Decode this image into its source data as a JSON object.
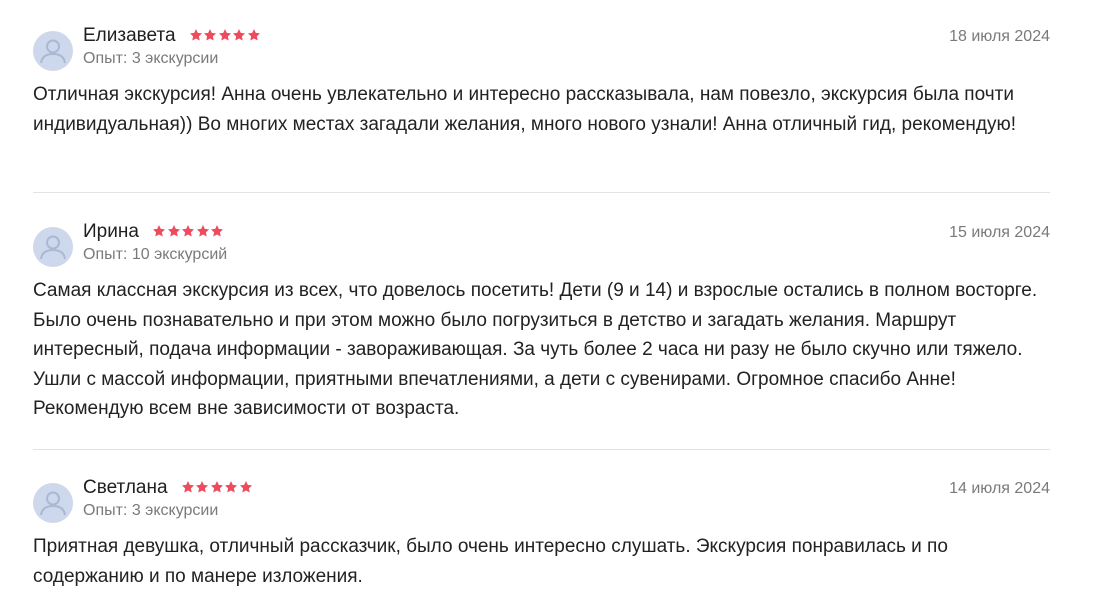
{
  "colors": {
    "star": "#ef4b5e",
    "muted_text": "#7a7a7a",
    "avatar_bg": "#cdd8ec",
    "divider": "#e3e3e3"
  },
  "reviews": [
    {
      "author": "Елизавета",
      "rating": 5,
      "experience": "Опыт: 3 экскурсии",
      "date": "18 июля 2024",
      "text": "Отличная экскурсия! Анна очень увлекательно и интересно рассказывала, нам повезло, экскурсия была почти индивидуальная)) Во многих местах загадали желания, много нового узнали! Анна отличный гид, рекомендую!"
    },
    {
      "author": "Ирина",
      "rating": 5,
      "experience": "Опыт: 10 экскурсий",
      "date": "15 июля 2024",
      "text": "Самая классная экскурсия из всех, что довелось посетить! Дети (9 и 14) и взрослые остались в полном восторге. Было очень познавательно и при этом можно было погрузиться в детство и загадать желания. Маршрут интересный, подача информации - завораживающая. За чуть более 2 часа ни разу не было скучно или тяжело. Ушли с массой информации, приятными впечатлениями, а дети с сувенирами. Огромное спасибо Анне! Рекомендую всем вне зависимости от возраста."
    },
    {
      "author": "Светлана",
      "rating": 5,
      "experience": "Опыт: 3 экскурсии",
      "date": "14 июля 2024",
      "text": "Приятная девушка, отличный рассказчик, было очень интересно слушать. Экскурсия понравилась и по содержанию и по манере изложения."
    }
  ]
}
